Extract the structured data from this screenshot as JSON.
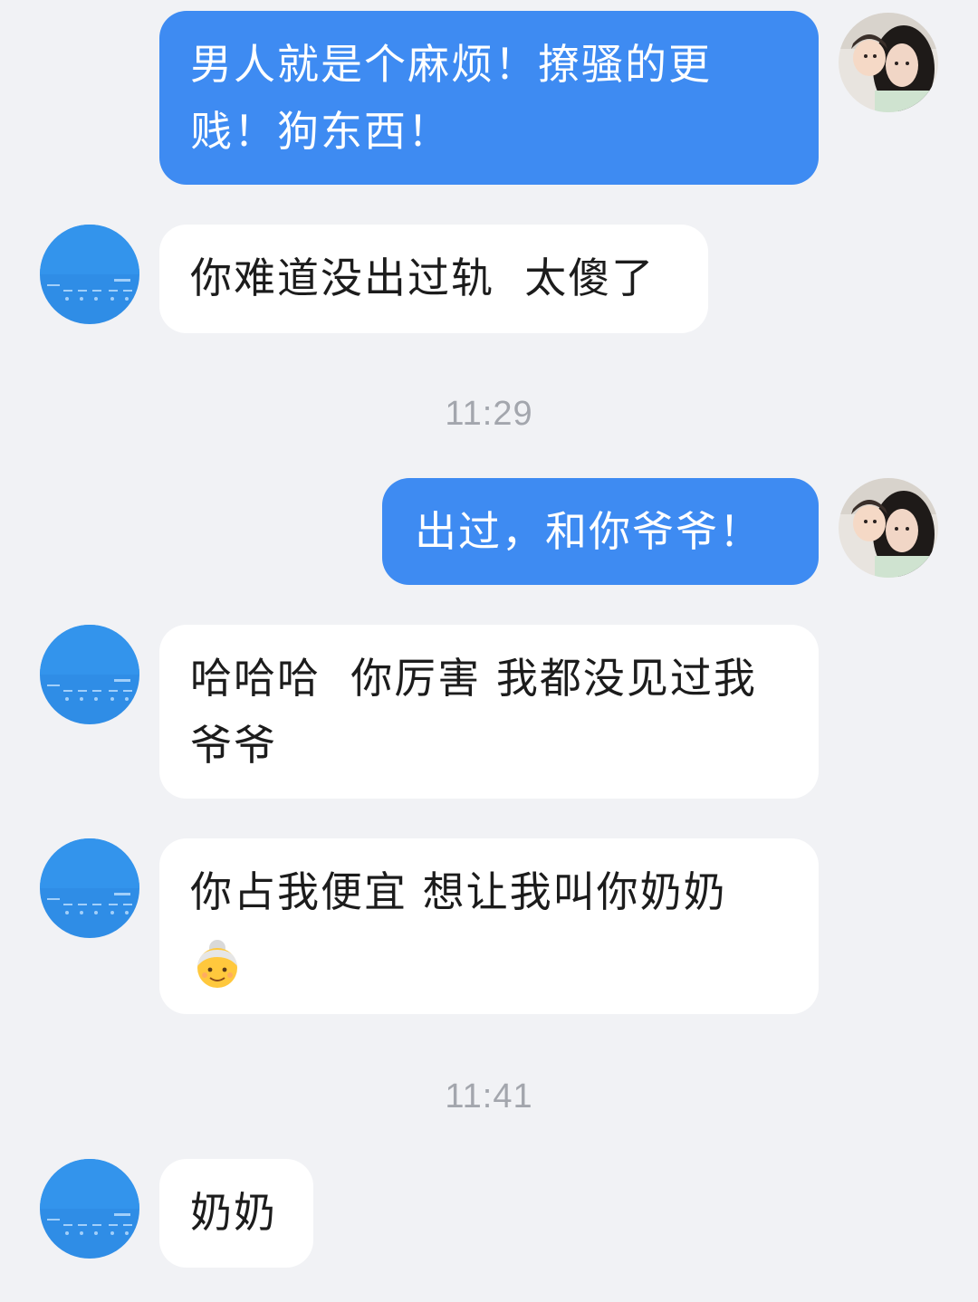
{
  "colors": {
    "background": "#f1f2f5",
    "outgoing_bubble": "#3e8bf2",
    "incoming_bubble": "#ffffff",
    "timestamp": "#a3a6ad"
  },
  "messages": [
    {
      "direction": "outgoing",
      "text": "男人就是个麻烦！撩骚的更贱！狗东西！",
      "avatar": "self-avatar-photo"
    },
    {
      "direction": "incoming",
      "text": "你难道没出过轨  太傻了",
      "avatar": "contact-avatar-weather-screenshot"
    },
    {
      "timestamp": "11:29"
    },
    {
      "direction": "outgoing",
      "text": "出过，和你爷爷！",
      "avatar": "self-avatar-photo"
    },
    {
      "direction": "incoming",
      "text": "哈哈哈  你厉害 我都没见过我爷爷",
      "avatar": "contact-avatar-weather-screenshot"
    },
    {
      "direction": "incoming",
      "text": "你占我便宜 想让我叫你奶奶",
      "emoji": "older-woman-emoji",
      "avatar": "contact-avatar-weather-screenshot"
    },
    {
      "timestamp": "11:41"
    },
    {
      "direction": "incoming",
      "text": "奶奶",
      "avatar": "contact-avatar-weather-screenshot"
    }
  ]
}
